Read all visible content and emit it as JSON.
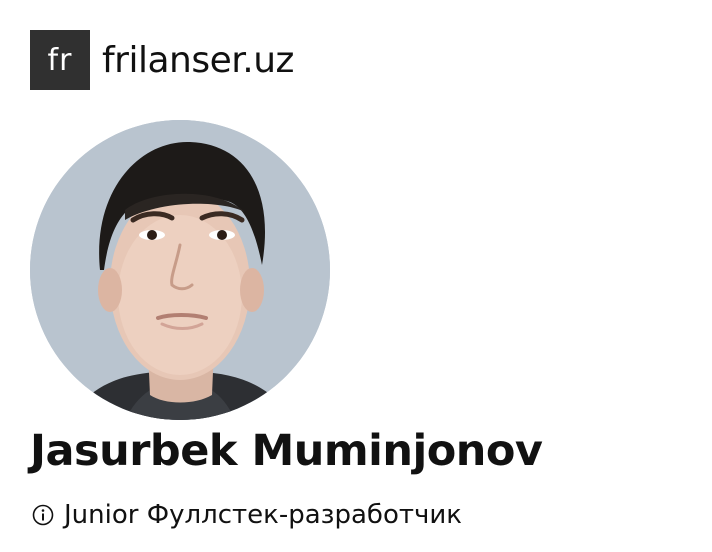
{
  "brand": {
    "logo_text": "fr",
    "name": "frilanser.uz"
  },
  "profile": {
    "avatar_icon": "profile-photo",
    "name": "Jasurbek Muminjonov",
    "role": "Junior Фуллстек-разработчик",
    "role_icon": "info-icon"
  },
  "colors": {
    "logo_bg": "#303030",
    "avatar_bg": "#b9c4cf",
    "text": "#111111"
  }
}
